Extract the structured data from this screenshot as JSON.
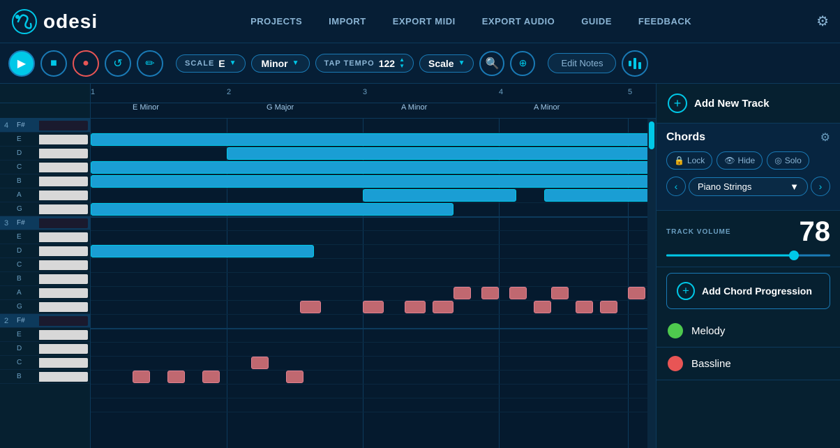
{
  "header": {
    "logo_text": "odesi",
    "nav": [
      "PROJECTS",
      "IMPORT",
      "EXPORT MIDI",
      "EXPORT AUDIO",
      "GUIDE",
      "FEEDBACK"
    ]
  },
  "toolbar": {
    "scale_label": "SCALE",
    "scale_key": "E",
    "scale_mode": "Minor",
    "tempo_label": "TAP TEMPO",
    "tempo_value": "122",
    "scale_type": "Scale",
    "edit_notes": "Edit Notes"
  },
  "timeline": {
    "markers": [
      "1",
      "2",
      "3",
      "4",
      "5"
    ],
    "chord_labels": [
      "E Minor",
      "G Major",
      "A Minor",
      "A Minor"
    ]
  },
  "piano_keys": {
    "notes": [
      "F#",
      "E",
      "D",
      "C",
      "B",
      "A",
      "G",
      "F#",
      "E",
      "D",
      "C",
      "B",
      "A",
      "G",
      "F#",
      "E",
      "D",
      "C",
      "B"
    ]
  },
  "right_panel": {
    "add_track_label": "Add New Track",
    "chords_title": "Chords",
    "lock_label": "Lock",
    "hide_label": "Hide",
    "solo_label": "Solo",
    "instrument": "Piano Strings",
    "volume_label": "TRACK VOLUME",
    "volume_value": "78",
    "volume_percent": 78,
    "add_chord_label": "Add Chord Progression",
    "tracks": [
      {
        "name": "Melody",
        "dot_class": "dot-green"
      },
      {
        "name": "Bassline",
        "dot_class": "dot-red"
      }
    ]
  }
}
